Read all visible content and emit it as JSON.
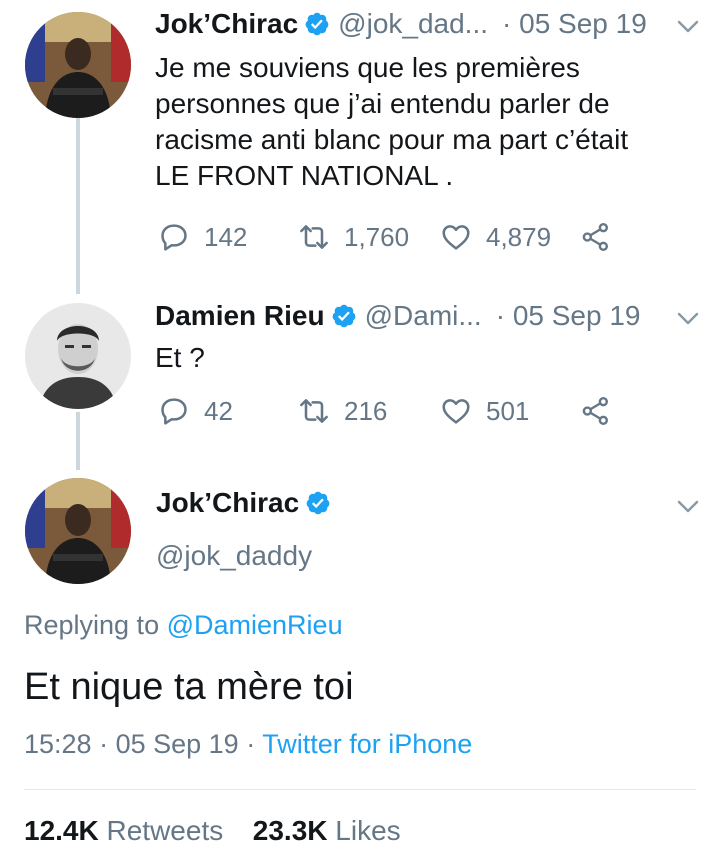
{
  "tweets": [
    {
      "name": "Jok’Chirac",
      "handle": "@jok_dad...",
      "date": "· 05 Sep 19",
      "text_lines": [
        "Je me souviens que les premières",
        "personnes que j’ai entendu parler de",
        "racisme anti blanc pour ma part c’était",
        "LE FRONT NATIONAL ."
      ],
      "replies": "142",
      "retweets": "1,760",
      "likes": "4,879"
    },
    {
      "name": "Damien Rieu",
      "handle": "@Dami...",
      "date": "· 05 Sep 19",
      "text_lines": [
        "Et ?"
      ],
      "replies": "42",
      "retweets": "216",
      "likes": "501"
    }
  ],
  "main_tweet": {
    "name": "Jok’Chirac",
    "handle": "@jok_daddy",
    "replying_prefix": "Replying to",
    "replying_to": "@DamienRieu",
    "text": "Et nique ta mère toi",
    "time": "15:28",
    "date": "· 05 Sep 19 ·",
    "app": "Twitter for iPhone",
    "retweets_count": "12.4K",
    "retweets_label": "Retweets",
    "likes_count": "23.3K",
    "likes_label": "Likes"
  },
  "colors": {
    "accent": "#1da1f2",
    "secondary_text": "#657786",
    "thread_line": "#ccd6dd"
  },
  "icons": [
    "verified-badge-icon",
    "chevron-down-icon",
    "reply-icon",
    "retweet-icon",
    "like-icon",
    "share-icon"
  ]
}
